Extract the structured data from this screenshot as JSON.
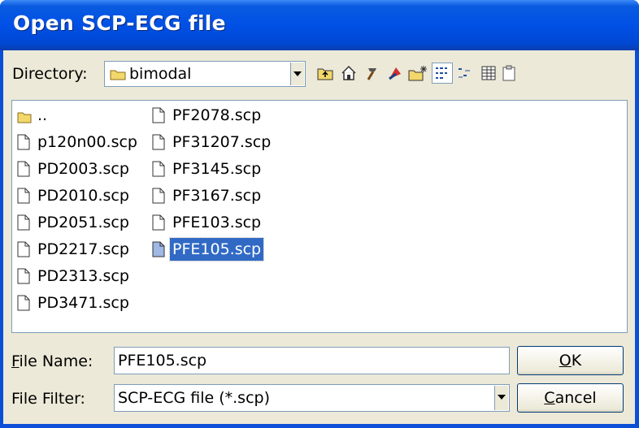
{
  "window": {
    "title": "Open SCP-ECG file"
  },
  "directory": {
    "label": "Directory:",
    "value": "bimodal"
  },
  "toolbar": {
    "icons": [
      "up-folder-icon",
      "home-icon",
      "hammer-icon",
      "bookmark-icon",
      "new-folder-icon",
      "list-view-icon",
      "details-view-icon",
      "grid-view-icon",
      "clipboard-icon"
    ]
  },
  "files": {
    "col1": [
      "..",
      "p120n00.scp",
      "PD2003.scp",
      "PD2010.scp",
      "PD2051.scp",
      "PD2217.scp",
      "PD2313.scp",
      "PD3471.scp"
    ],
    "col2": [
      "PF2078.scp",
      "PF31207.scp",
      "PF3145.scp",
      "PF3167.scp",
      "PFE103.scp",
      "PFE105.scp"
    ],
    "selected": "PFE105.scp"
  },
  "filename": {
    "label_prefix": "F",
    "label_rest": "ile Name:",
    "value": "PFE105.scp"
  },
  "filter": {
    "label": "File Filter:",
    "value": "SCP-ECG file (*.scp)"
  },
  "buttons": {
    "ok_ul": "O",
    "ok_rest": "K",
    "cancel_ul": "C",
    "cancel_rest": "ancel"
  },
  "colors": {
    "titlebar": "#0050e6",
    "selection": "#316ac5",
    "face": "#ece9d8"
  }
}
